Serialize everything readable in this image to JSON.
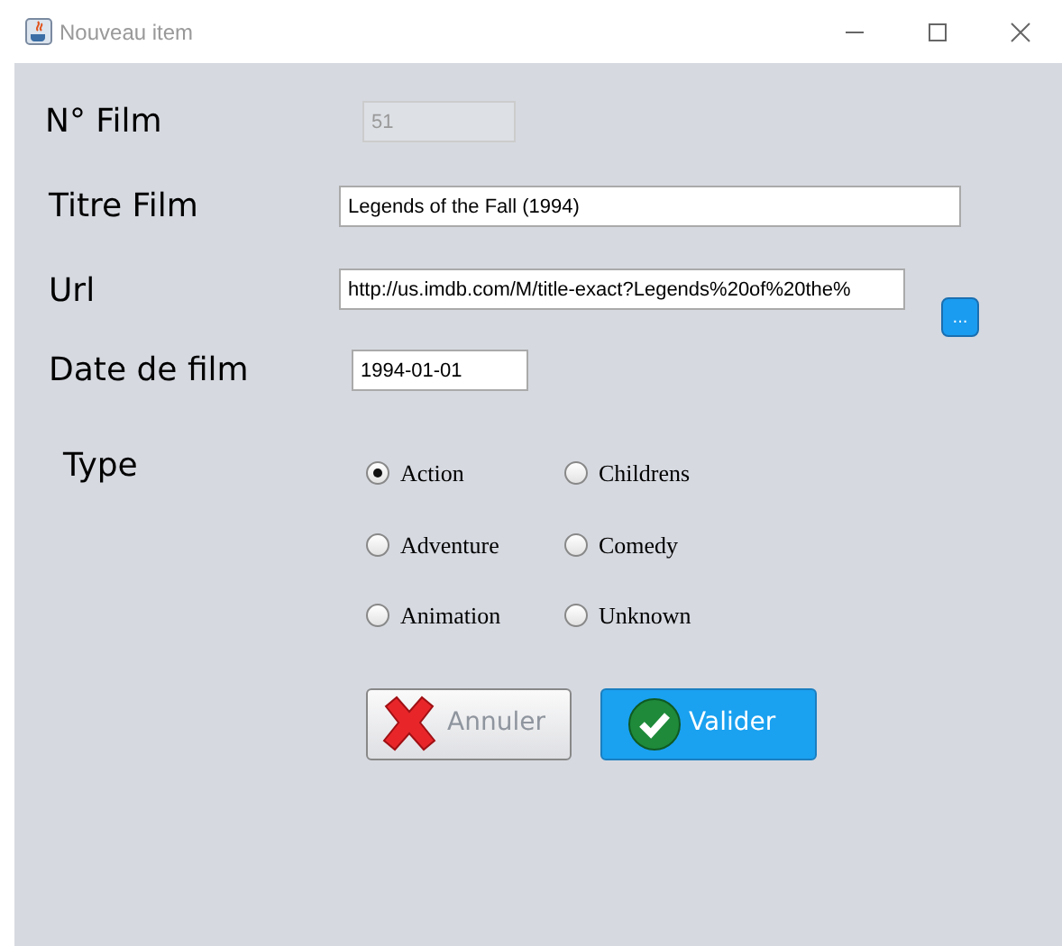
{
  "window": {
    "title": "Nouveau item"
  },
  "form": {
    "numero": {
      "label": "N° Film",
      "value": "51",
      "disabled": true
    },
    "titre": {
      "label": "Titre Film",
      "value": "Legends of the Fall (1994)"
    },
    "url": {
      "label": "Url",
      "value": "http://us.imdb.com/M/title-exact?Legends%20of%20the%",
      "browse": "..."
    },
    "date": {
      "label": "Date de film",
      "value": "1994-01-01"
    },
    "type": {
      "label": "Type",
      "options": [
        {
          "label": "Action",
          "selected": true
        },
        {
          "label": "Childrens",
          "selected": false
        },
        {
          "label": "Adventure",
          "selected": false
        },
        {
          "label": "Comedy",
          "selected": false
        },
        {
          "label": "Animation",
          "selected": false
        },
        {
          "label": "Unknown",
          "selected": false
        }
      ]
    }
  },
  "buttons": [
    {
      "kind": "cancel",
      "label": "Annuler"
    },
    {
      "kind": "ok",
      "label": "Valider"
    }
  ]
}
